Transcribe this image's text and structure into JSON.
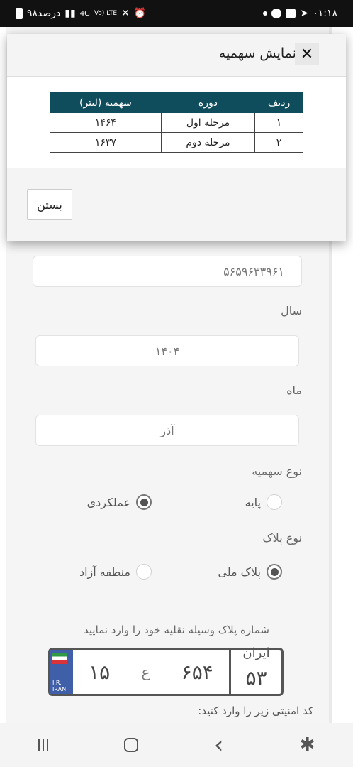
{
  "status_bar": {
    "time": "۰۱:۱۸",
    "battery_text": "۹۸درصد",
    "network_a": "4G",
    "network_b": "Vo) LTE"
  },
  "modal": {
    "title": "نمایش سهمیه",
    "close_icon": "close-icon",
    "table": {
      "headers": [
        "ردیف",
        "دوره",
        "سهمیه (لیتر)"
      ],
      "rows": [
        [
          "۱",
          "مرحله اول",
          "۱۴۶۴"
        ],
        [
          "۲",
          "مرحله دوم",
          "۱۶۳۷"
        ]
      ]
    },
    "close_button": "بستن"
  },
  "form": {
    "id_value": "۵۶۵۹۶۳۳۹۶۱",
    "year_label": "سال",
    "year_value": "۱۴۰۴",
    "month_label": "ماه",
    "month_value": "آذر",
    "quota_type_label": "نوع سهمیه",
    "quota_options": [
      {
        "label": "پایه",
        "selected": false
      },
      {
        "label": "عملکردی",
        "selected": true
      }
    ],
    "plate_type_label": "نوع پلاک",
    "plate_options": [
      {
        "label": "پلاک ملی",
        "selected": true
      },
      {
        "label": "منطقه آزاد",
        "selected": false
      }
    ],
    "plate_hint": "شماره پلاک وسیله نقلیه خود را وارد نمایید",
    "plate": {
      "left_number": "۱۵",
      "letter": "ع",
      "middle_number": "۶۵۴",
      "region_label": "ایران",
      "region_number": "۵۳",
      "country_top": "I.R.",
      "country_bottom": "IRAN"
    },
    "captcha_label": "کد امنیتی زیر را وارد کنید:"
  },
  "navbar": {
    "back_icon": "‹",
    "accessibility_icon": "accessibility-icon"
  },
  "colors": {
    "table_header": "#0f4c5c",
    "plate_flag_strip": "#3f5fa8"
  }
}
